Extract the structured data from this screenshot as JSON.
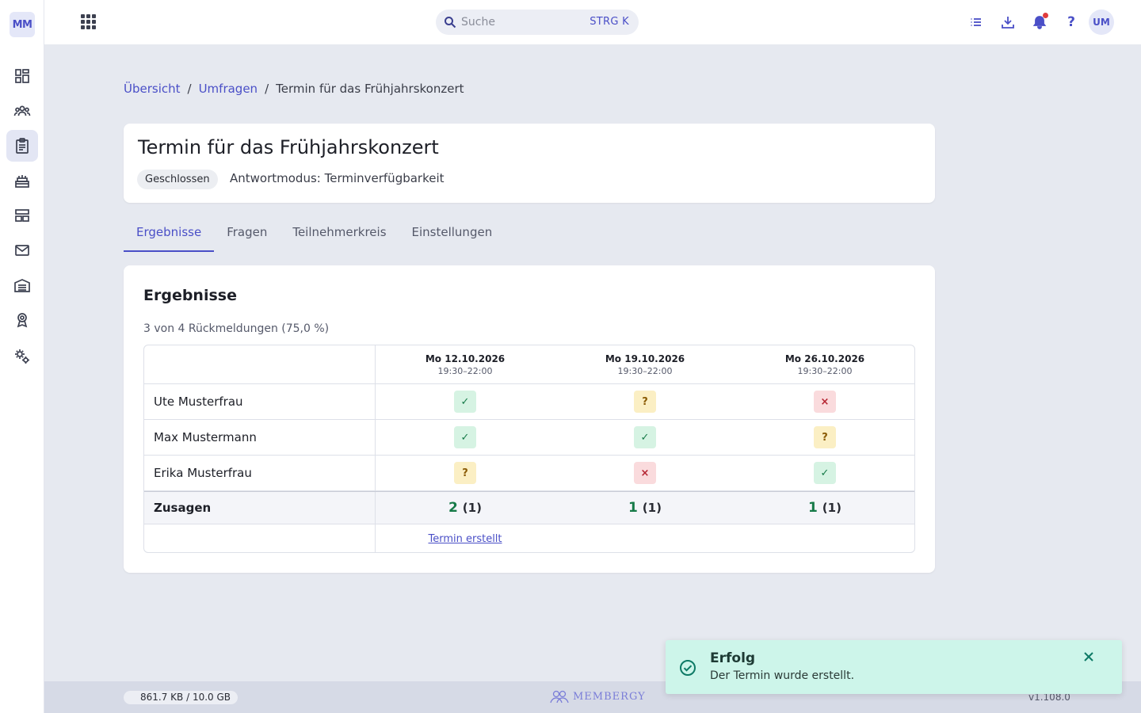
{
  "app": {
    "logo_text": "MM",
    "avatar_text": "UM"
  },
  "sidebar": {
    "items": [
      {
        "name": "dashboard"
      },
      {
        "name": "members"
      },
      {
        "name": "surveys",
        "active": true
      },
      {
        "name": "events"
      },
      {
        "name": "tables"
      },
      {
        "name": "mail"
      },
      {
        "name": "organization"
      },
      {
        "name": "awards"
      },
      {
        "name": "settings"
      }
    ]
  },
  "topbar": {
    "search_placeholder": "Suche",
    "search_shortcut": "STRG K",
    "help_label": "?"
  },
  "breadcrumb": {
    "items": [
      "Übersicht",
      "Umfragen",
      "Termin für das Frühjahrskonzert"
    ],
    "separator": "/"
  },
  "header": {
    "title": "Termin für das Frühjahrskonzert",
    "status": "Geschlossen",
    "mode": "Antwortmodus:  Terminverfügbarkeit"
  },
  "tabs": [
    {
      "label": "Ergebnisse",
      "active": true
    },
    {
      "label": "Fragen"
    },
    {
      "label": "Teilnehmerkreis"
    },
    {
      "label": "Einstellungen"
    }
  ],
  "results": {
    "title": "Ergebnisse",
    "count_text": "3 von 4 Rückmeldungen (75,0 %)",
    "columns": [
      {
        "date": "Mo 12.10.2026",
        "time": "19:30–22:00"
      },
      {
        "date": "Mo 19.10.2026",
        "time": "19:30–22:00"
      },
      {
        "date": "Mo 26.10.2026",
        "time": "19:30–22:00"
      }
    ],
    "rows": [
      {
        "name": "Ute Musterfrau",
        "answers": [
          "yes",
          "maybe",
          "no"
        ]
      },
      {
        "name": "Max Mustermann",
        "answers": [
          "yes",
          "yes",
          "maybe"
        ]
      },
      {
        "name": "Erika Musterfrau",
        "answers": [
          "maybe",
          "no",
          "yes"
        ]
      }
    ],
    "answer_symbols": {
      "yes": "✓",
      "maybe": "?",
      "no": "×"
    },
    "summary": {
      "label": "Zusagen",
      "values": [
        {
          "count": "2",
          "maybe": "(1)"
        },
        {
          "count": "1",
          "maybe": "(1)"
        },
        {
          "count": "1",
          "maybe": "(1)"
        }
      ]
    },
    "termin_link": "Termin erstellt"
  },
  "footer": {
    "storage": "861.7 KB / 10.0 GB",
    "brand": "MEMBERGY",
    "version": "v1.108.0"
  },
  "toast": {
    "title": "Erfolg",
    "message": "Der Termin wurde erstellt."
  },
  "colors": {
    "accent": "#4a4fc7",
    "yes_bg": "#d6f3e3",
    "maybe_bg": "#fbefc4",
    "no_bg": "#fadbdd",
    "toast_bg": "#cdf5ea"
  }
}
